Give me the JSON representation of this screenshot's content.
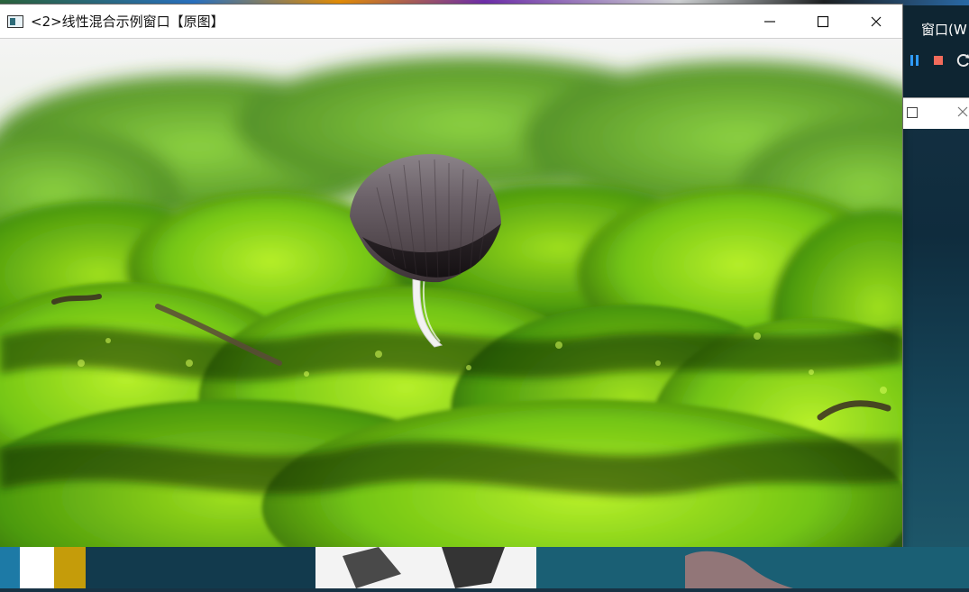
{
  "window": {
    "title": "<2>线性混合示例窗口【原图】",
    "icons": {
      "app": "opencv-window-icon",
      "minimize": "minimize-icon",
      "maximize": "maximize-icon",
      "close": "close-icon"
    }
  },
  "side_window": {
    "title": "窗口(W",
    "toolbar_icons": [
      "pause-icon",
      "stop-icon",
      "restart-icon"
    ]
  },
  "colors": {
    "moss_light": "#9be01e",
    "moss_dark": "#1f4a06",
    "mushroom_cap": "#6f6770",
    "mushroom_stem": "#f2f2f2",
    "stop_red": "#f26b5b",
    "pause_blue": "#2f9bff"
  }
}
